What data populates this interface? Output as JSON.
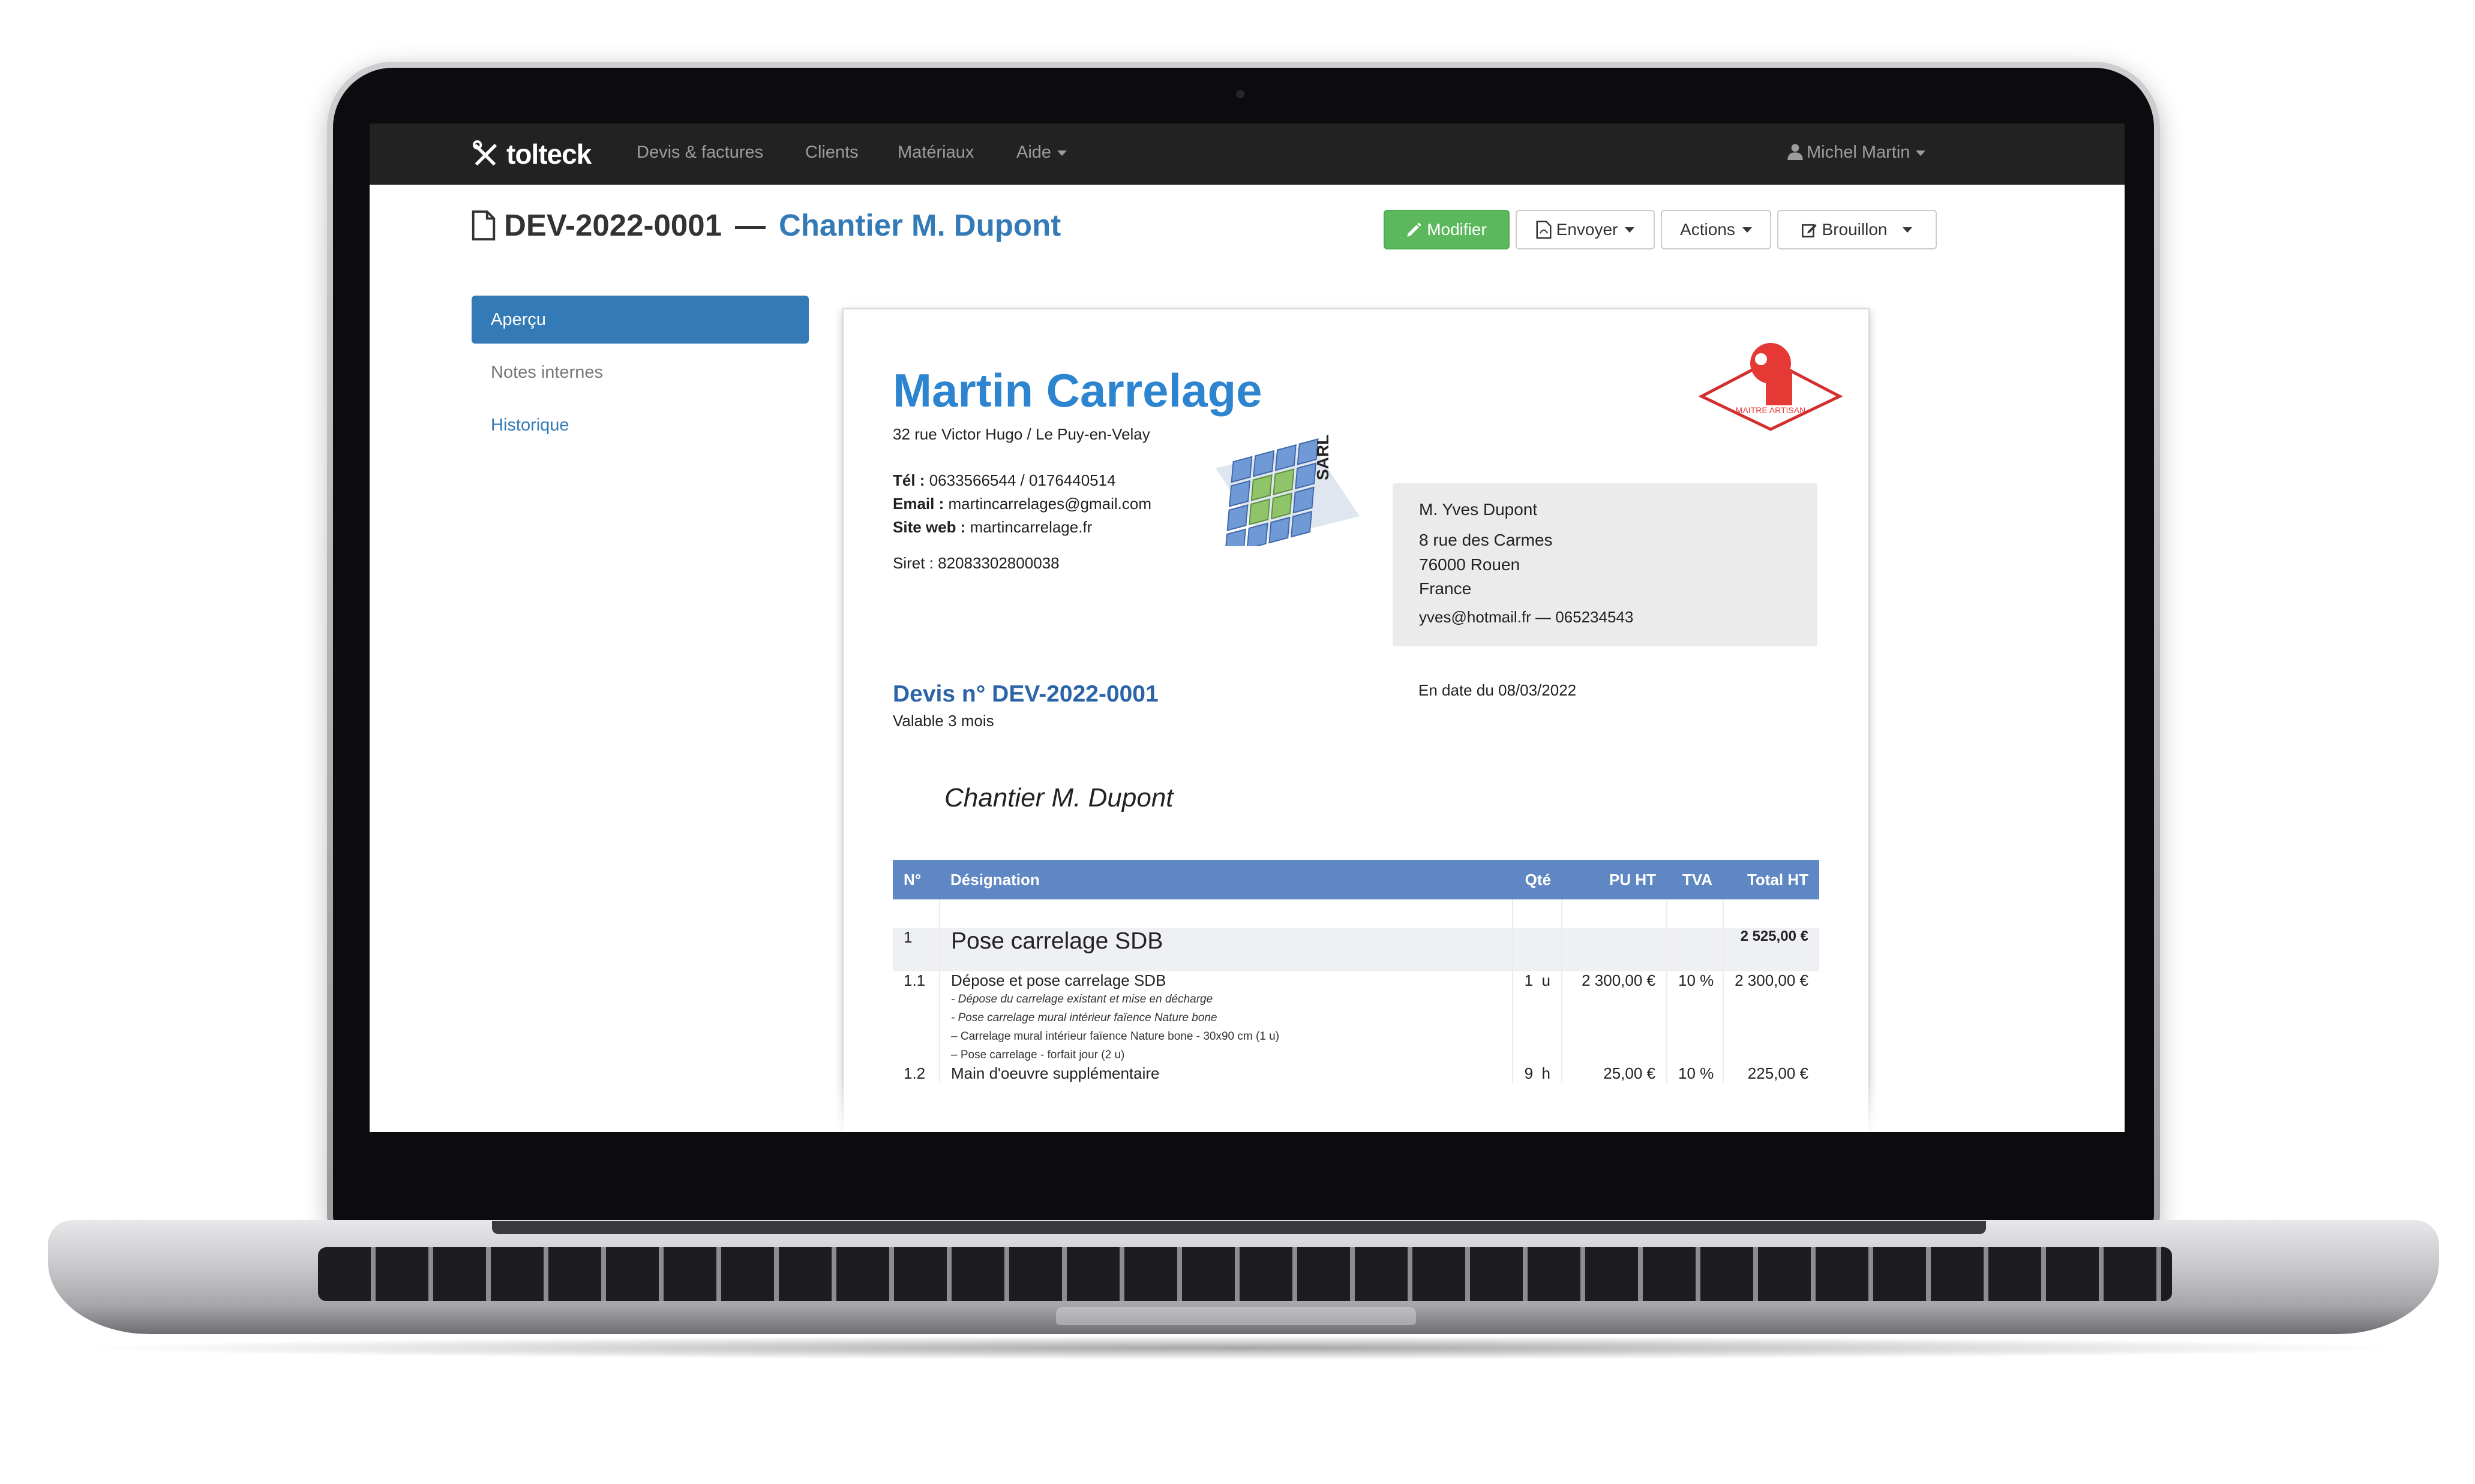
{
  "navbar": {
    "brand": "tolteck",
    "items": [
      "Devis & factures",
      "Clients",
      "Matériaux",
      "Aide"
    ],
    "user": "Michel Martin"
  },
  "header": {
    "doc_ref": "DEV-2022-0001",
    "separator": "—",
    "title": "Chantier M. Dupont",
    "buttons": {
      "modify": "Modifier",
      "send": "Envoyer",
      "actions": "Actions",
      "status": "Brouillon"
    }
  },
  "sidebar": {
    "items": [
      "Aperçu",
      "Notes internes",
      "Historique"
    ]
  },
  "quote": {
    "company": "Martin Carrelage",
    "address": "32 rue Victor Hugo / Le Puy-en-Velay",
    "tel_label": "Tél :",
    "tel": "0633566544 / 0176440514",
    "email_label": "Email :",
    "email": "martincarrelages@gmail.com",
    "site_label": "Site web :",
    "site": "martincarrelage.fr",
    "siret": "Siret : 82083302800038",
    "sarl_text": "SARL",
    "artisan_text": "MAITRE ARTISAN",
    "client": {
      "name": "M. Yves Dupont",
      "street": "8 rue des Carmes",
      "city": "76000 Rouen",
      "country": "France",
      "contact": "yves@hotmail.fr — 065234543"
    },
    "number": "Devis n° DEV-2022-0001",
    "validity": "Valable 3 mois",
    "date": "En date du 08/03/2022",
    "project": "Chantier M. Dupont",
    "table": {
      "headers": [
        "N°",
        "Désignation",
        "Qté",
        "PU HT",
        "TVA",
        "Total HT"
      ],
      "section": {
        "num": "1",
        "title": "Pose carrelage SDB",
        "total": "2 525,00 €"
      },
      "rows": [
        {
          "num": "1.1",
          "designation": "Dépose et pose carrelage SDB",
          "notes": [
            "- Dépose du carrelage existant et mise en décharge",
            "- Pose carrelage mural intérieur faïence Nature bone"
          ],
          "subitems": [
            "–    Carrelage mural intérieur faïence Nature bone - 30x90 cm (1 u)",
            "–    Pose carrelage - forfait jour (2 u)"
          ],
          "qty": "1",
          "unit": "u",
          "pu": "2 300,00 €",
          "tva": "10 %",
          "total": "2 300,00 €"
        },
        {
          "num": "1.2",
          "designation": "Main d'oeuvre supplémentaire",
          "qty": "9",
          "unit": "h",
          "pu": "25,00 €",
          "tva": "10 %",
          "total": "225,00 €"
        }
      ]
    }
  },
  "colors": {
    "navbar": "#222222",
    "primary": "#337ab7",
    "success": "#5cb85c",
    "table_header": "#5f87c4",
    "company": "#2d84cf"
  }
}
